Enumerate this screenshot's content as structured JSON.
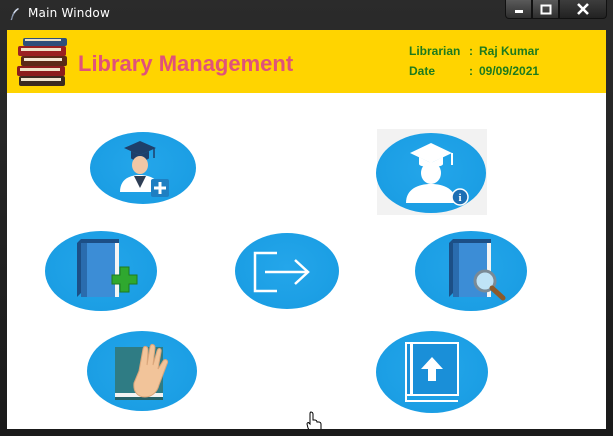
{
  "window": {
    "title": "Main Window"
  },
  "header": {
    "app_title": "Library Management",
    "librarian_label": "Librarian",
    "librarian_value": "Raj Kumar",
    "date_label": "Date",
    "date_value": "09/09/2021",
    "separator": ":"
  },
  "tiles": [
    {
      "name": "add-student",
      "icon": "student-add-icon"
    },
    {
      "name": "student-info",
      "icon": "student-info-icon"
    },
    {
      "name": "add-book",
      "icon": "book-add-icon"
    },
    {
      "name": "logout",
      "icon": "logout-icon"
    },
    {
      "name": "search-book",
      "icon": "book-search-icon"
    },
    {
      "name": "issue-book",
      "icon": "book-hand-icon"
    },
    {
      "name": "return-book",
      "icon": "book-upload-icon"
    }
  ],
  "colors": {
    "header_bg": "#ffd400",
    "title_color": "#e0527a",
    "info_color": "#1d7a1d",
    "tile_blue": "#1b9ee4"
  }
}
